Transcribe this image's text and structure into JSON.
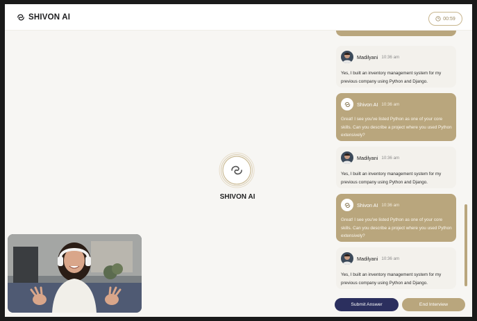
{
  "header": {
    "brand": "SHIVON AI",
    "timer": "00:59"
  },
  "center": {
    "title": "SHIVON AI"
  },
  "messages": [
    {
      "sender": "Madilyani",
      "role": "user",
      "time": "10:36 am",
      "text": "Yes, I built an inventory management system for my previous company using Python and Django."
    },
    {
      "sender": "Shivon AI",
      "role": "ai",
      "time": "10:36 am",
      "text": "Great! I see you've listed Python as one of your core skills. Can you describe a project where you used Python extensively?"
    },
    {
      "sender": "Madilyani",
      "role": "user",
      "time": "10:36 am",
      "text": "Yes, I built an inventory management system for my previous company using Python and Django."
    },
    {
      "sender": "Shivon AI",
      "role": "ai",
      "time": "10:36 am",
      "text": "Great! I see you've listed Python as one of your core skills. Can you describe a project where you used Python extensively?"
    },
    {
      "sender": "Madilyani",
      "role": "user",
      "time": "10:36 am",
      "text": "Yes, I built an inventory management system for my previous company using Python and Django."
    }
  ],
  "actions": {
    "submit_label": "Submit Answer",
    "end_label": "End Interview"
  },
  "colors": {
    "accent_gold": "#b9a67d",
    "accent_navy": "#2b2f5e",
    "background": "#f7f6f3"
  },
  "icons": {
    "brand": "swirl-logo-icon",
    "timer": "clock-icon"
  }
}
